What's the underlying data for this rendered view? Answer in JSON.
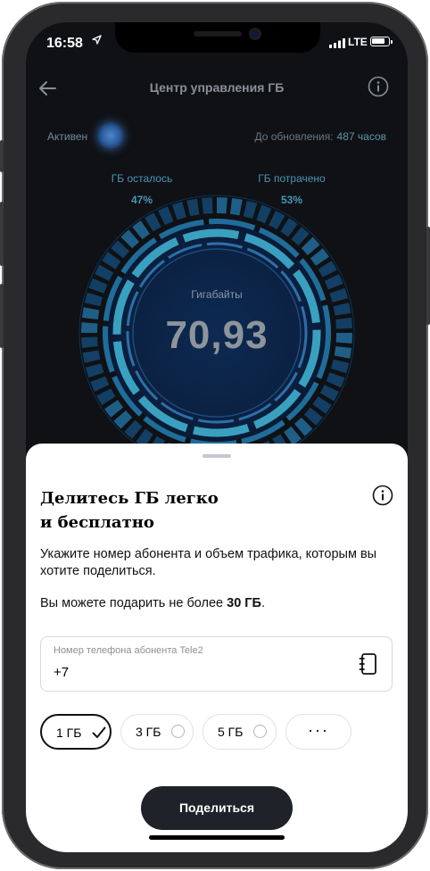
{
  "status_bar": {
    "time": "16:58",
    "location_icon": "location-arrow-icon",
    "network": "LTE"
  },
  "header": {
    "title": "Центр управления ГБ",
    "back_icon": "arrow-left-icon",
    "info_icon": "info-icon"
  },
  "status": {
    "state_label": "Активен",
    "update_label": "До обновления:",
    "update_value": "487 часов"
  },
  "stats": {
    "left": {
      "label": "ГБ осталось",
      "value": "47%"
    },
    "right": {
      "label": "ГБ потрачено",
      "value": "53%"
    }
  },
  "gauge": {
    "label": "Гигабайты",
    "value": "70,93",
    "remaining_fraction": 0.47,
    "accent": "#3a9cb8"
  },
  "sheet": {
    "title_line1": "Делитесь ГБ легко",
    "title_line2": "и бесплатно",
    "description": "Укажите номер абонента и объем трафика, которым вы хотите поделиться.",
    "limit_prefix": "Вы можете подарить не более ",
    "limit_value": "30 ГБ",
    "limit_suffix": ".",
    "phone_field": {
      "label": "Номер телефона абонента Tele2",
      "value": "+7"
    },
    "options": [
      {
        "label": "1 ГБ",
        "selected": true
      },
      {
        "label": "3 ГБ",
        "selected": false
      },
      {
        "label": "5 ГБ",
        "selected": false
      },
      {
        "label": "···",
        "selected": false
      }
    ],
    "share_button": "Поделиться"
  }
}
